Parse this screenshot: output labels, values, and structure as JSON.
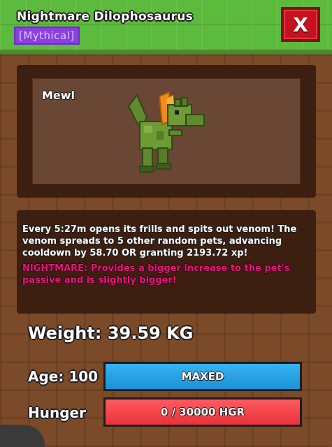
{
  "header": {
    "title": "Nightmare Dilophosaurus",
    "rarity": "[Mythical]",
    "close_label": "X"
  },
  "pet": {
    "name": "Mewl",
    "icon": "dilophosaurus-pet-icon"
  },
  "description": {
    "ability": "Every 5:27m opens its frills and spits out venom! The venom spreads to 5 other random pets, advancing cooldown by 58.70 OR granting 2193.72 xp!",
    "nightmare_prefix": "NIGHTMARE:",
    "nightmare_text": " Provides a bigger increase to the pet's passive and is slightly bigger!"
  },
  "stats": {
    "weight": "Weight: 39.59 KG",
    "age_label": "Age: 100",
    "age_bar_text": "MAXED",
    "age_fill": 1.0,
    "hunger_label": "Hunger",
    "hunger_bar_text": "0 / 30000 HGR",
    "hunger_fill": 1.0
  },
  "colors": {
    "rarity": "#8a3fe0",
    "close_button": "#c6121e",
    "age_bar": "#1c91d8",
    "hunger_bar": "#e9323b",
    "nightmare_text": "#e0187a"
  }
}
